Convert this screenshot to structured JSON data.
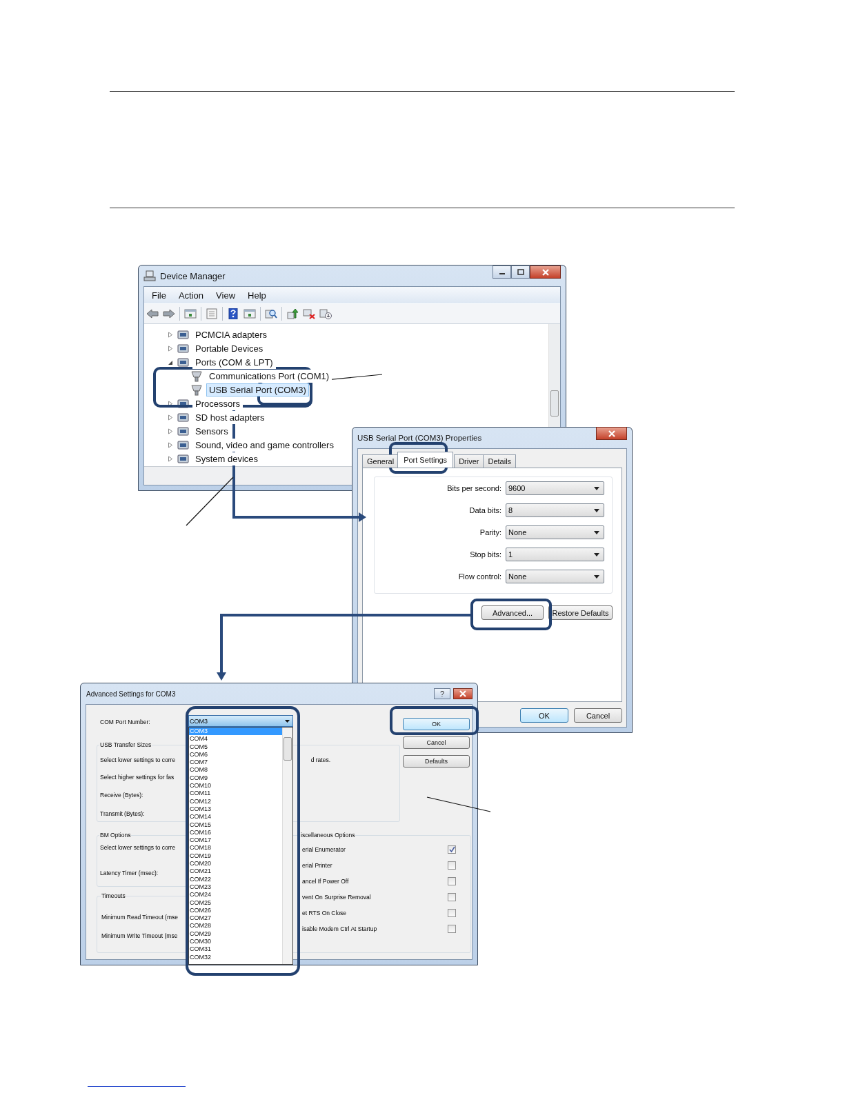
{
  "device_manager": {
    "title": "Device Manager",
    "menu": [
      "File",
      "Action",
      "View",
      "Help"
    ],
    "tree": [
      {
        "label": "PCMCIA adapters",
        "expanded": false,
        "selected": false
      },
      {
        "label": "Portable Devices",
        "expanded": false,
        "selected": false
      },
      {
        "label": "Ports (COM & LPT)",
        "expanded": true,
        "selected": false,
        "children": [
          {
            "label": "Communications Port (COM1)",
            "selected": false
          },
          {
            "label": "USB Serial Port (COM3)",
            "selected": true
          }
        ]
      },
      {
        "label": "Processors",
        "expanded": false,
        "selected": false
      },
      {
        "label": "SD host adapters",
        "expanded": false,
        "selected": false
      },
      {
        "label": "Sensors",
        "expanded": false,
        "selected": false
      },
      {
        "label": "Sound, video and game controllers",
        "expanded": false,
        "selected": false
      },
      {
        "label": "System devices",
        "expanded": false,
        "selected": false
      }
    ]
  },
  "properties": {
    "title": "USB Serial Port (COM3) Properties",
    "tabs": [
      {
        "label": "General",
        "selected": false
      },
      {
        "label": "Port Settings",
        "selected": true
      },
      {
        "label": "Driver",
        "selected": false
      },
      {
        "label": "Details",
        "selected": false
      }
    ],
    "settings": [
      {
        "label": "Bits per second:",
        "value": "9600"
      },
      {
        "label": "Data bits:",
        "value": "8"
      },
      {
        "label": "Parity:",
        "value": "None"
      },
      {
        "label": "Stop bits:",
        "value": "1"
      },
      {
        "label": "Flow control:",
        "value": "None"
      }
    ],
    "panel_buttons": [
      "Advanced...",
      "Restore Defaults"
    ],
    "buttons": [
      "OK",
      "Cancel"
    ]
  },
  "advanced": {
    "title": "Advanced Settings for COM3",
    "help_button": "?",
    "com_port": {
      "label": "COM Port Number:",
      "value": "COM3",
      "options": [
        {
          "label": "COM3",
          "selected": true
        },
        {
          "label": "COM4",
          "selected": false
        },
        {
          "label": "COM5",
          "selected": false
        },
        {
          "label": "COM6",
          "selected": false
        },
        {
          "label": "COM7",
          "selected": false
        },
        {
          "label": "COM8",
          "selected": false
        },
        {
          "label": "COM9",
          "selected": false
        },
        {
          "label": "COM10",
          "selected": false
        },
        {
          "label": "COM11",
          "selected": false
        },
        {
          "label": "COM12",
          "selected": false
        },
        {
          "label": "COM13",
          "selected": false
        },
        {
          "label": "COM14",
          "selected": false
        },
        {
          "label": "COM15",
          "selected": false
        },
        {
          "label": "COM16",
          "selected": false
        },
        {
          "label": "COM17",
          "selected": false
        },
        {
          "label": "COM18",
          "selected": false
        },
        {
          "label": "COM19",
          "selected": false
        },
        {
          "label": "COM20",
          "selected": false
        },
        {
          "label": "COM21",
          "selected": false
        },
        {
          "label": "COM22",
          "selected": false
        },
        {
          "label": "COM23",
          "selected": false
        },
        {
          "label": "COM24",
          "selected": false
        },
        {
          "label": "COM25",
          "selected": false
        },
        {
          "label": "COM26",
          "selected": false
        },
        {
          "label": "COM27",
          "selected": false
        },
        {
          "label": "COM28",
          "selected": false
        },
        {
          "label": "COM29",
          "selected": false
        },
        {
          "label": "COM30",
          "selected": false
        },
        {
          "label": "COM31",
          "selected": false
        },
        {
          "label": "COM32",
          "selected": false
        }
      ]
    },
    "buttons": [
      "OK",
      "Cancel",
      "Defaults"
    ],
    "usb_transfer": {
      "title": "USB Transfer Sizes",
      "lines": [
        "Select lower settings to corre",
        "Select higher settings for fas"
      ],
      "line_end": "d rates.",
      "fields": [
        "Receive (Bytes):",
        "Transmit (Bytes):"
      ]
    },
    "bm_options": {
      "title": "BM Options",
      "lines": [
        "Select lower settings to corre"
      ],
      "fields": [
        "Latency Timer (msec):"
      ]
    },
    "timeouts": {
      "title": "Timeouts",
      "fields": [
        "Minimum Read Timeout (mse",
        "Minimum Write Timeout (mse"
      ]
    },
    "misc": {
      "title": "iscellaneous Options",
      "options": [
        {
          "label": "erial Enumerator",
          "checked": true
        },
        {
          "label": "erial Printer",
          "checked": false
        },
        {
          "label": "ancel If Power Off",
          "checked": false
        },
        {
          "label": "vent On Surprise Removal",
          "checked": false
        },
        {
          "label": "et RTS On Close",
          "checked": false
        },
        {
          "label": "isable Modem Ctrl At Startup",
          "checked": false
        }
      ]
    }
  }
}
